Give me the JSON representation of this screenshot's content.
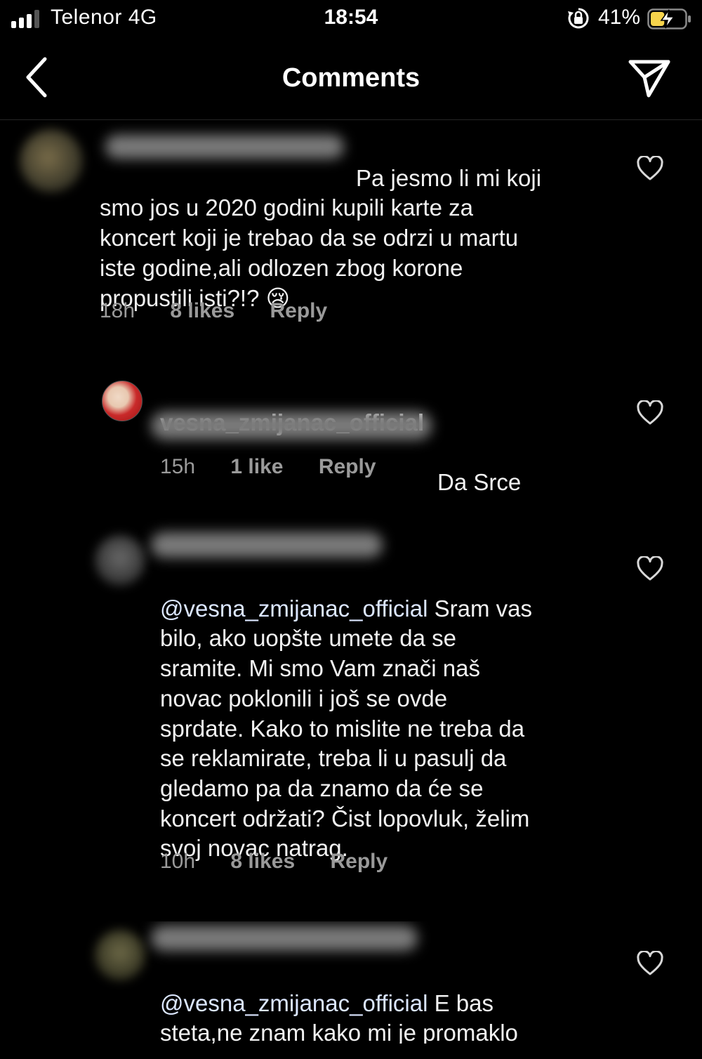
{
  "status_bar": {
    "carrier": "Telenor 4G",
    "time": "18:54",
    "battery_percent": "41%",
    "battery_level": 0.41,
    "charging": true
  },
  "header": {
    "title": "Comments"
  },
  "comments": [
    {
      "username": "",
      "text": "Pa jesmo li mi koji\nsmo jos u 2020 godini kupili karte za\nkoncert koji je trebao da se odrzi u martu\niste godine,ali odlozen zbog korone\npropustili isti?!? 😢",
      "time": "18h",
      "likes": "8 likes",
      "reply": "Reply"
    },
    {
      "username": "vesna_zmijanac_official",
      "text": "Da Srce",
      "time": "15h",
      "likes": "1 like",
      "reply": "Reply"
    },
    {
      "mention": "@vesna_zmijanac_official",
      "text": " Sram vas\nbilo, ako uopšte umete da se\nsramite. Mi smo Vam znači naš\nnovac poklonili i još se ovde\nsprdate. Kako to mislite ne treba da\nse reklamirate, treba li u pasulj da\ngledamo pa da znamo da će se\nkoncert održati? Čist lopovluk, želim\nsvoj novac natrag.",
      "time": "10h",
      "likes": "8 likes",
      "reply": "Reply"
    },
    {
      "mention": "@vesna_zmijanac_official",
      "text": "  E bas\nsteta,ne znam kako mi je promaklo\nda ce se odrazati. Nadam se da ce"
    }
  ],
  "icons": {
    "back": "chevron-left-icon",
    "send": "paper-plane-icon",
    "like": "heart-outline-icon"
  }
}
